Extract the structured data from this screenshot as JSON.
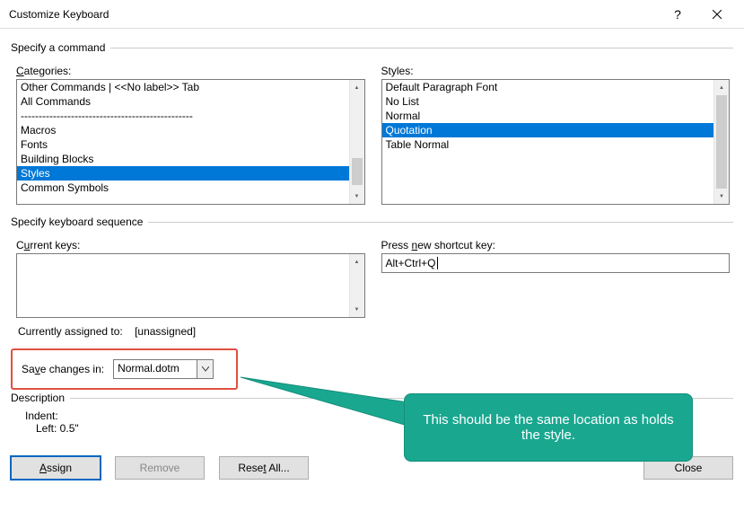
{
  "window": {
    "title": "Customize Keyboard"
  },
  "specify_command": {
    "legend": "Specify a command",
    "categories_label_pre": "C",
    "categories_label_post": "ategories:",
    "styles_label_pre": "S",
    "styles_label_post": "tyles:",
    "categories": [
      "Other Commands | <<No label>> Tab",
      "All Commands",
      "------------------------------------------------",
      "Macros",
      "Fonts",
      "Building Blocks",
      "Styles",
      "Common Symbols"
    ],
    "categories_selected": "Styles",
    "styles": [
      "Default Paragraph Font",
      "No List",
      "Normal",
      "Quotation",
      "Table Normal"
    ],
    "styles_selected": "Quotation"
  },
  "keyboard_sequence": {
    "legend": "Specify keyboard sequence",
    "current_keys_label_pre": "C",
    "current_keys_label_mid": "u",
    "current_keys_label_post": "rrent keys:",
    "press_new_label_pre": "Press ",
    "press_new_underline": "n",
    "press_new_label_post": "ew shortcut key:",
    "new_shortcut_value": "Alt+Ctrl+Q"
  },
  "assigned": {
    "label": "Currently assigned to:",
    "value": "[unassigned]"
  },
  "save_in": {
    "label_pre": "Sa",
    "label_underline": "v",
    "label_post": "e changes in:",
    "value": "Normal.dotm"
  },
  "description": {
    "legend": "Description",
    "line1": "Indent:",
    "line2": "Left:  0.5\""
  },
  "buttons": {
    "assign_pre": "",
    "assign_underline": "A",
    "assign_post": "ssign",
    "remove": "Remove",
    "reset_pre": "Rese",
    "reset_underline": "t",
    "reset_post": " All...",
    "close": "Close"
  },
  "callout": {
    "text": "This should be the same location as holds the style."
  }
}
